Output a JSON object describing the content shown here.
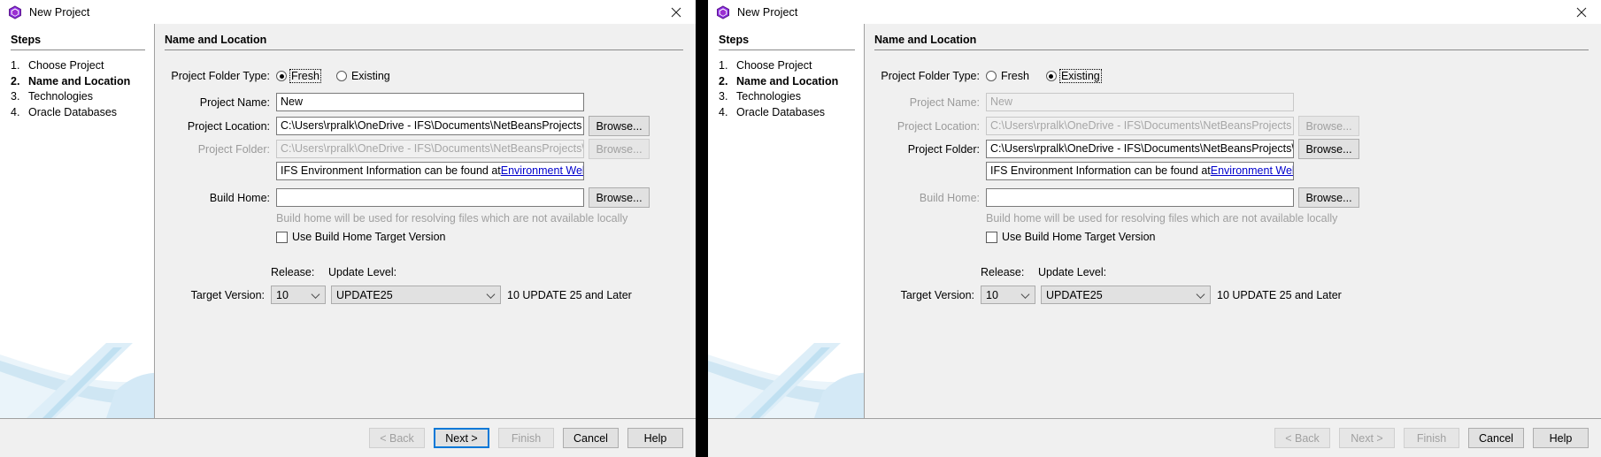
{
  "window": {
    "title": "New Project",
    "app_icon": "cube-icon",
    "close_icon": "close-icon"
  },
  "steps": {
    "heading": "Steps",
    "items": [
      {
        "num": "1.",
        "label": "Choose Project",
        "current": false
      },
      {
        "num": "2.",
        "label": "Name and Location",
        "current": true
      },
      {
        "num": "3.",
        "label": "Technologies",
        "current": false
      },
      {
        "num": "4.",
        "label": "Oracle Databases",
        "current": false
      }
    ]
  },
  "panel": {
    "heading": "Name and Location"
  },
  "form": {
    "folder_type_label": "Project Folder Type:",
    "folder_type_fresh": "Fresh",
    "folder_type_existing": "Existing",
    "project_name_label": "Project Name:",
    "project_name_value": "New",
    "project_location_label": "Project Location:",
    "project_location_value": "C:\\Users\\rpralk\\OneDrive - IFS\\Documents\\NetBeansProjects",
    "project_folder_label": "Project Folder:",
    "project_folder_value": "C:\\Users\\rpralk\\OneDrive - IFS\\Documents\\NetBeansProjects\\New",
    "env_info_prefix": "IFS Environment Information can be found at ",
    "env_info_link": "Environment Web",
    "env_info_suffix": ".",
    "build_home_label": "Build Home:",
    "build_home_value": "",
    "build_home_hint": "Build home will be used for resolving files which are not available locally",
    "use_build_home_checkbox": "Use Build Home Target Version",
    "browse_label": "Browse...",
    "release_label": "Release:",
    "update_level_label": "Update Level:",
    "target_version_label": "Target Version:",
    "release_value": "10",
    "update_level_value": "UPDATE25",
    "target_version_trailing": "10 UPDATE 25 and Later"
  },
  "footer": {
    "back": "< Back",
    "next": "Next >",
    "finish": "Finish",
    "cancel": "Cancel",
    "help": "Help"
  },
  "colors": {
    "accent": "#0078d7",
    "link": "#0000cc",
    "panel_bg": "#f0f0f0",
    "disabled_text": "#a0a0a0",
    "icon_purple": "#7a2f9e"
  }
}
